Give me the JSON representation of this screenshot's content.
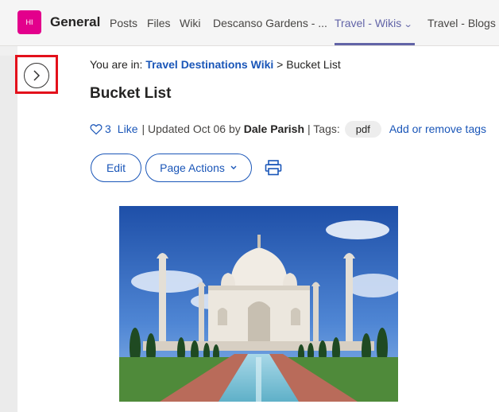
{
  "header": {
    "team_initials": "HI",
    "channel_name": "General",
    "tabs": [
      {
        "label": "Posts"
      },
      {
        "label": "Files"
      },
      {
        "label": "Wiki"
      },
      {
        "label": "Descanso Gardens - ..."
      },
      {
        "label": "Travel - Wikis",
        "active": true
      },
      {
        "label": "Travel - Blogs"
      }
    ]
  },
  "breadcrumb": {
    "prefix": "You are in:",
    "link": "Travel Destinations Wiki",
    "separator": ">",
    "current": "Bucket List"
  },
  "page": {
    "title": "Bucket List",
    "like_count": "3",
    "like_label": "Like",
    "updated_text": "| Updated Oct 06 by",
    "author": "Dale Parish",
    "tags_label": "| Tags:",
    "tag": "pdf",
    "add_tags_label": "Add or remove tags"
  },
  "actions": {
    "edit_label": "Edit",
    "page_actions_label": "Page Actions"
  },
  "colors": {
    "accent": "#6264a7",
    "link": "#1a56b8",
    "highlight": "#e3101b",
    "team_avatar": "#e3008c"
  },
  "icons": [
    "chevron-right-icon",
    "heart-icon",
    "chevron-down-icon",
    "print-icon"
  ],
  "image": {
    "subject": "Taj Mahal"
  }
}
